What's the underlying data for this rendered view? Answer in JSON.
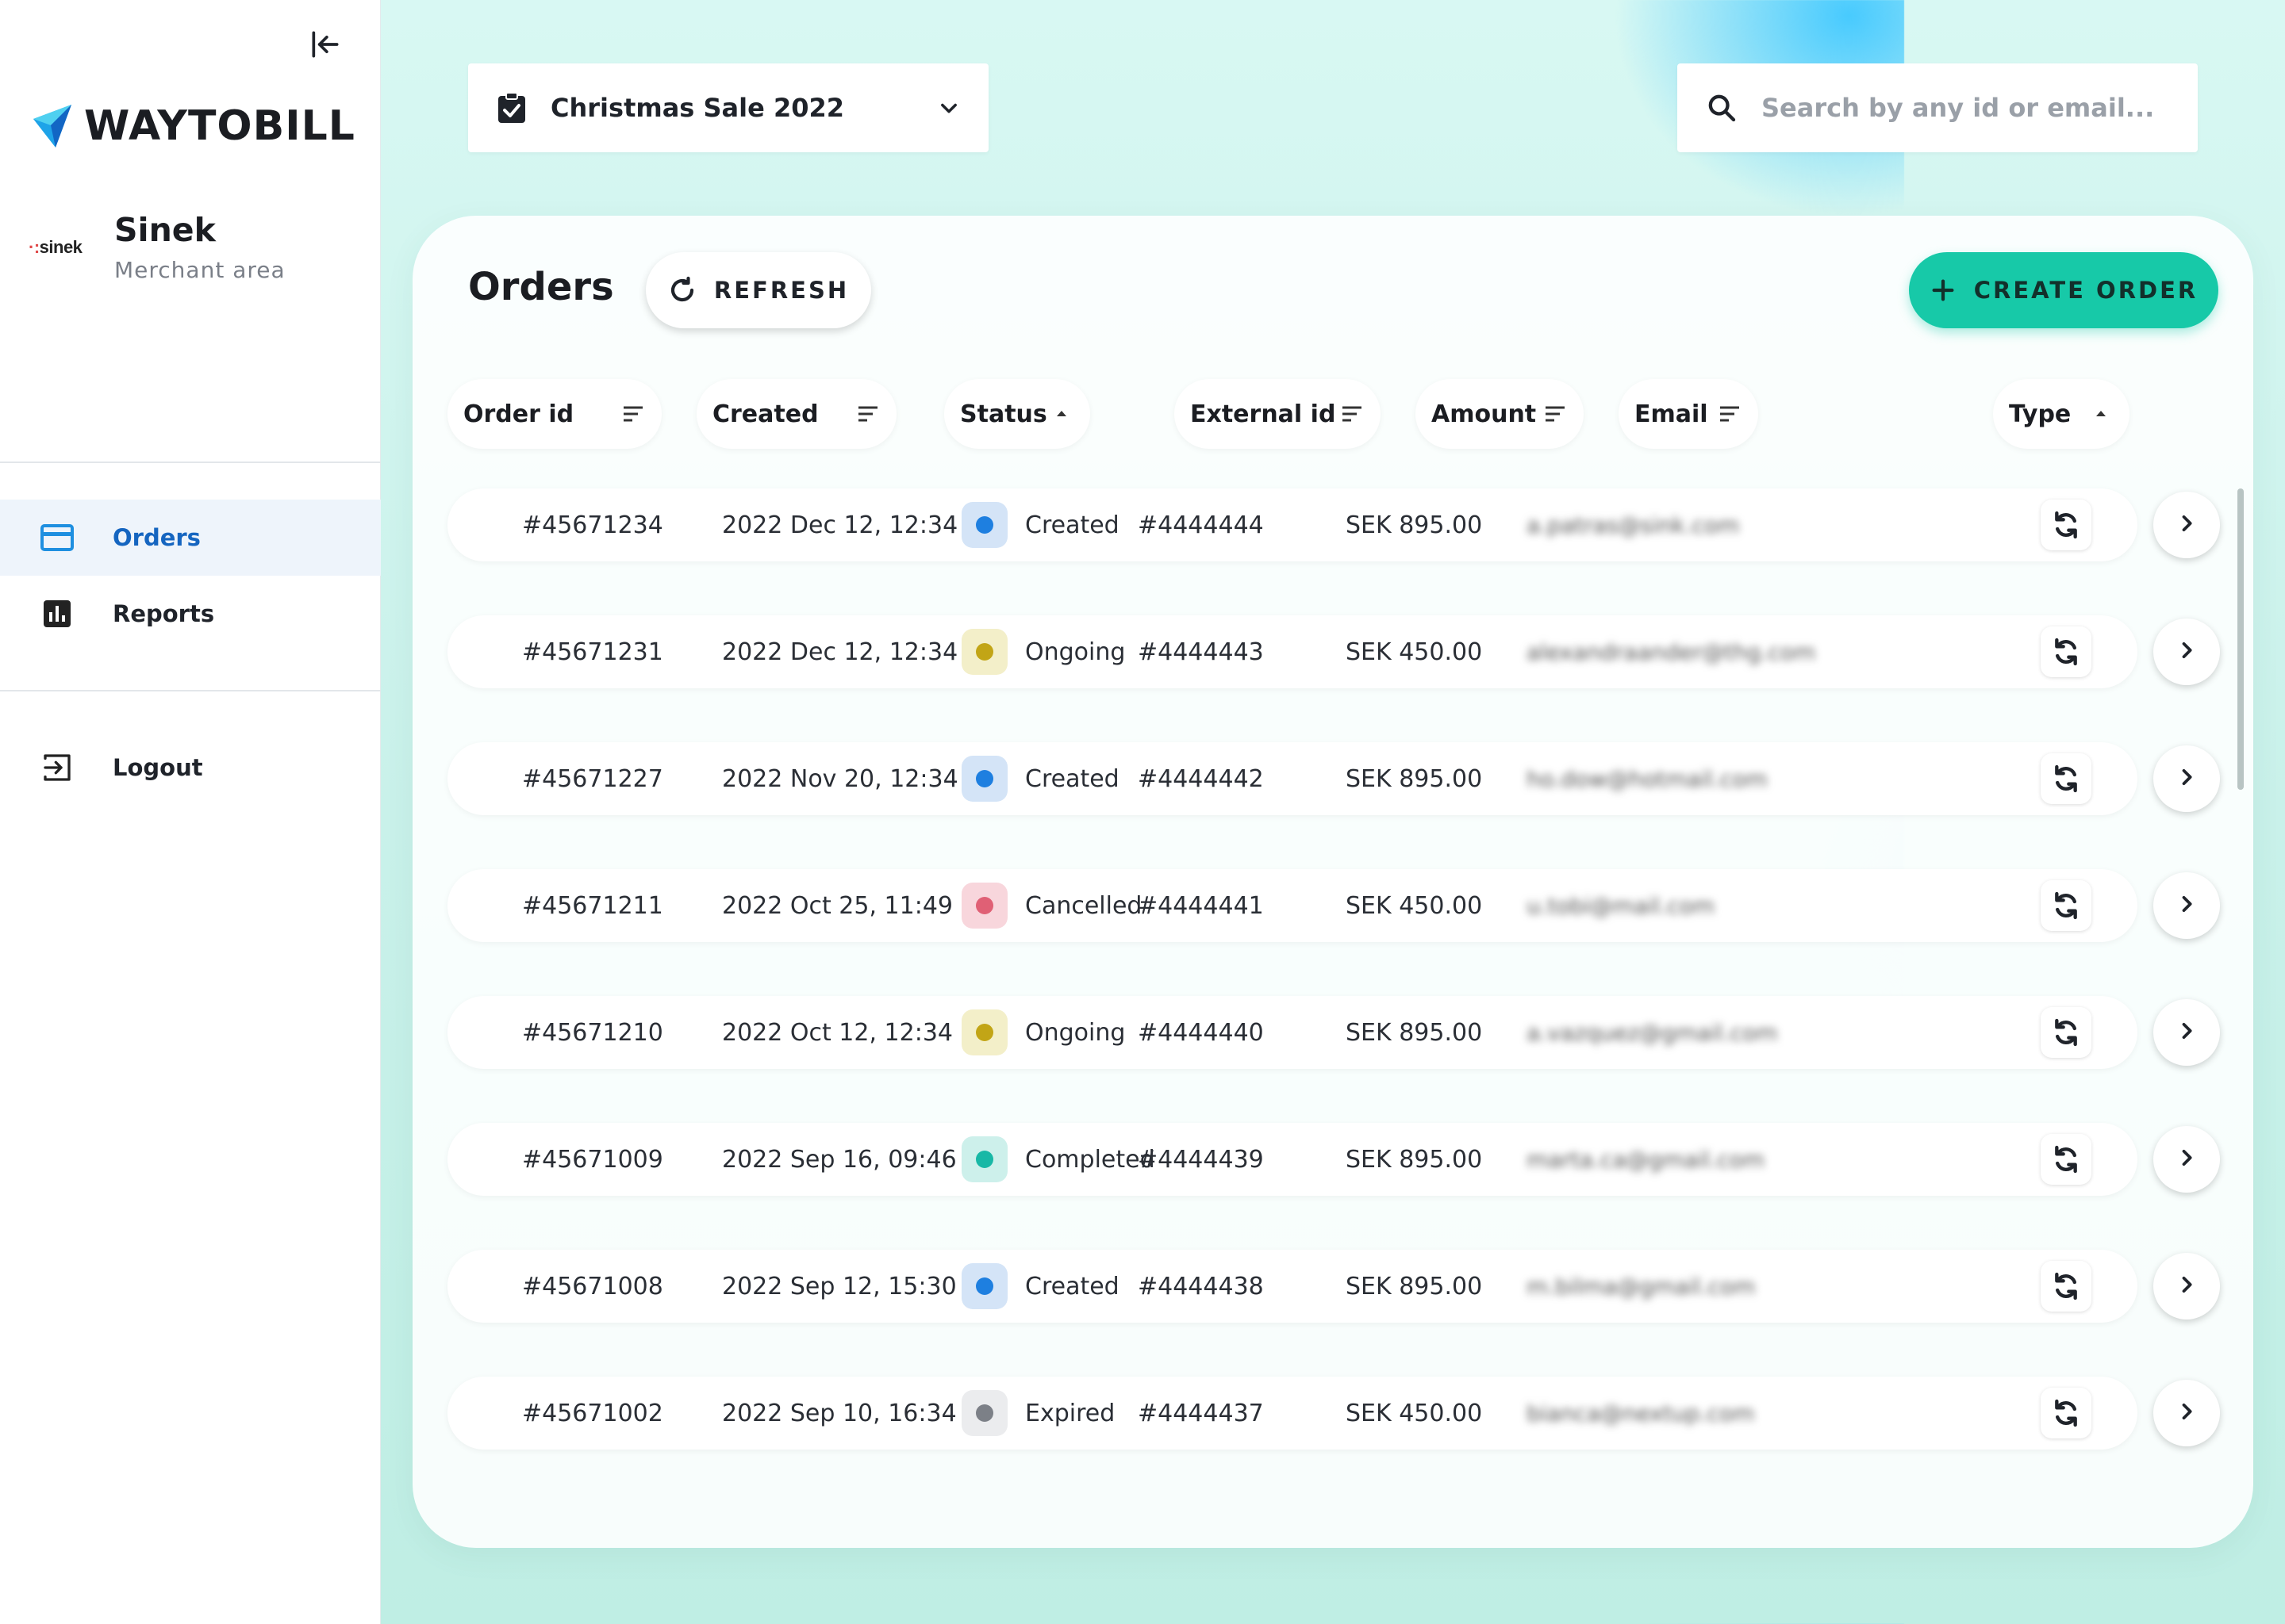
{
  "brand": {
    "name": "WAYTOBILL"
  },
  "merchant": {
    "logo_text": "sinek",
    "name": "Sinek",
    "subtitle": "Merchant area"
  },
  "nav": {
    "items": [
      {
        "label": "Orders",
        "icon": "card-icon",
        "active": true
      },
      {
        "label": "Reports",
        "icon": "bar-chart-icon",
        "active": false
      }
    ],
    "logout_label": "Logout"
  },
  "campaign": {
    "label": "Christmas Sale 2022"
  },
  "search": {
    "placeholder": "Search by any id or email..."
  },
  "orders": {
    "title": "Orders",
    "refresh_label": "REFRESH",
    "create_label": "CREATE ORDER",
    "columns": [
      {
        "label": "Order id",
        "icon": "sort-lines-icon"
      },
      {
        "label": "Created",
        "icon": "sort-lines-icon"
      },
      {
        "label": "Status",
        "icon": "sort-asc-icon"
      },
      {
        "label": "External id",
        "icon": "sort-lines-icon"
      },
      {
        "label": "Amount",
        "icon": "sort-lines-icon"
      },
      {
        "label": "Email",
        "icon": "sort-lines-icon"
      },
      {
        "label": "Type",
        "icon": "sort-asc-icon"
      }
    ],
    "status_colors": {
      "Created": {
        "dot": "#1e7fe0",
        "bg": "#d4e4f7"
      },
      "Ongoing": {
        "dot": "#c2a516",
        "bg": "#f3efc9"
      },
      "Cancelled": {
        "dot": "#e06075",
        "bg": "#f8d6dc"
      },
      "Completed": {
        "dot": "#18b8a6",
        "bg": "#cdf0eb"
      },
      "Expired": {
        "dot": "#7c8087",
        "bg": "#ebecee"
      }
    },
    "rows": [
      {
        "order_id": "#45671234",
        "created": "2022 Dec 12, 12:34",
        "status": "Created",
        "external_id": "#4444444",
        "amount": "SEK 895.00",
        "email": "a.patras@sink.com"
      },
      {
        "order_id": "#45671231",
        "created": "2022 Dec 12, 12:34",
        "status": "Ongoing",
        "external_id": "#4444443",
        "amount": "SEK 450.00",
        "email": "alexandraander@thg.com"
      },
      {
        "order_id": "#45671227",
        "created": "2022 Nov 20, 12:34",
        "status": "Created",
        "external_id": "#4444442",
        "amount": "SEK 895.00",
        "email": "ho.dow@hotmail.com"
      },
      {
        "order_id": "#45671211",
        "created": "2022 Oct 25, 11:49",
        "status": "Cancelled",
        "external_id": "#4444441",
        "amount": "SEK 450.00",
        "email": "u.tobi@mail.com"
      },
      {
        "order_id": "#45671210",
        "created": "2022 Oct 12, 12:34",
        "status": "Ongoing",
        "external_id": "#4444440",
        "amount": "SEK 895.00",
        "email": "a.vazquez@gmail.com"
      },
      {
        "order_id": "#45671009",
        "created": "2022 Sep 16, 09:46",
        "status": "Completed",
        "external_id": "#4444439",
        "amount": "SEK 895.00",
        "email": "marta.ca@gmail.com"
      },
      {
        "order_id": "#45671008",
        "created": "2022 Sep 12, 15:30",
        "status": "Created",
        "external_id": "#4444438",
        "amount": "SEK 895.00",
        "email": "m.bilma@gmail.com"
      },
      {
        "order_id": "#45671002",
        "created": "2022 Sep 10, 16:34",
        "status": "Expired",
        "external_id": "#4444437",
        "amount": "SEK 450.00",
        "email": "bianca@nextup.com"
      }
    ]
  }
}
